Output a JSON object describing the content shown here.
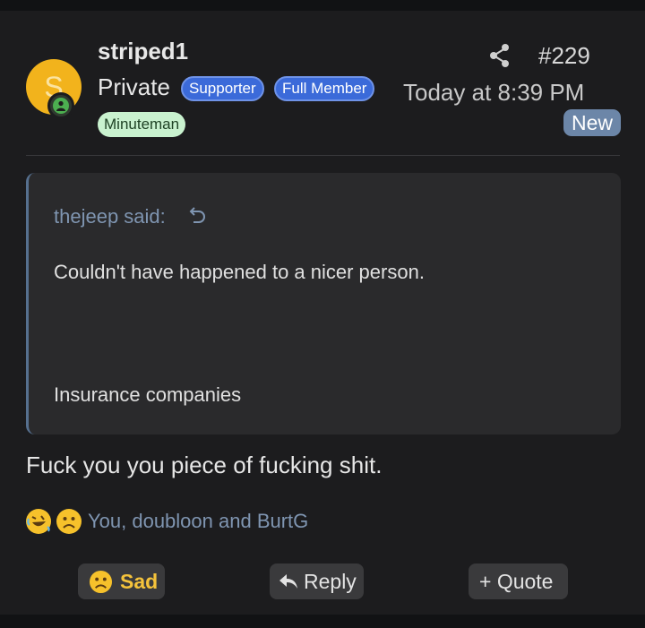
{
  "post": {
    "author": {
      "avatar_letter": "S",
      "username": "striped1",
      "rank": "Private",
      "badges": [
        "Supporter",
        "Full Member",
        "Minuteman"
      ],
      "online": true
    },
    "post_number": "#229",
    "timestamp": "Today at 8:39 PM",
    "new_label": "New",
    "quote": {
      "author_label": "thejeep said:",
      "line1": "Couldn't have happened to a nicer person.",
      "line2": "Insurance companies"
    },
    "message": "Fuck you you piece of fucking shit.",
    "reactions": {
      "icons": [
        "rofl-emoji",
        "sad-emoji"
      ],
      "text": "You, doubloon and BurtG"
    },
    "actions": {
      "sad_label": "Sad",
      "reply_label": "Reply",
      "quote_label": "+ Quote"
    }
  },
  "colors": {
    "background": "#1c1c1e",
    "badge_blue": "#3b6ad9",
    "badge_green": "#c9f2cf",
    "new_badge": "#6c86a8",
    "link": "#7f95b1",
    "avatar": "#f2b31c"
  }
}
